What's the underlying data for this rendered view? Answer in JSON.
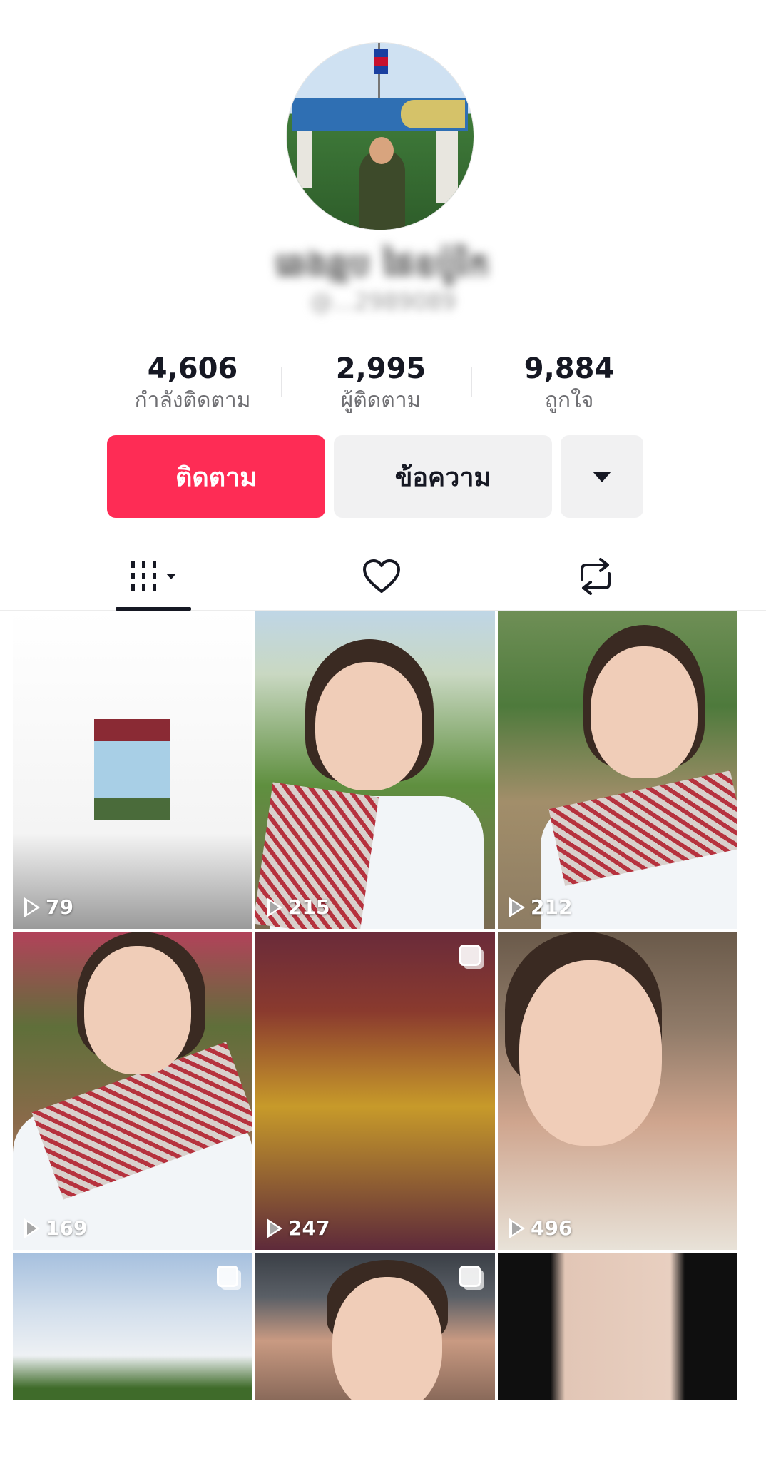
{
  "profile": {
    "display_name": "ឆេងឆ្មប ផៃឧប៉ូរិក",
    "username": "@...2989089"
  },
  "stats": [
    {
      "value": "4,606",
      "label": "กำลังติดตาม"
    },
    {
      "value": "2,995",
      "label": "ผู้ติดตาม"
    },
    {
      "value": "9,884",
      "label": "ถูกใจ"
    }
  ],
  "actions": {
    "follow_label": "ติดตาม",
    "message_label": "ข้อความ",
    "more_icon": "caret-down-icon"
  },
  "tabs": [
    {
      "name": "videos",
      "icon": "grid-icon",
      "active": true
    },
    {
      "name": "liked",
      "icon": "heart-icon",
      "active": false
    },
    {
      "name": "reposts",
      "icon": "repost-icon",
      "active": false
    }
  ],
  "videos": [
    {
      "views": "79"
    },
    {
      "views": "215"
    },
    {
      "views": "212"
    },
    {
      "views": "169"
    },
    {
      "views": "247",
      "multi": true
    },
    {
      "views": "496"
    },
    {
      "views": "",
      "multi": true
    },
    {
      "views": "",
      "multi": true
    },
    {
      "views": ""
    }
  ],
  "colors": {
    "accent": "#fe2c55",
    "button_gray": "#f1f1f2",
    "text": "#161823",
    "secondary_text": "#6f6f73"
  }
}
